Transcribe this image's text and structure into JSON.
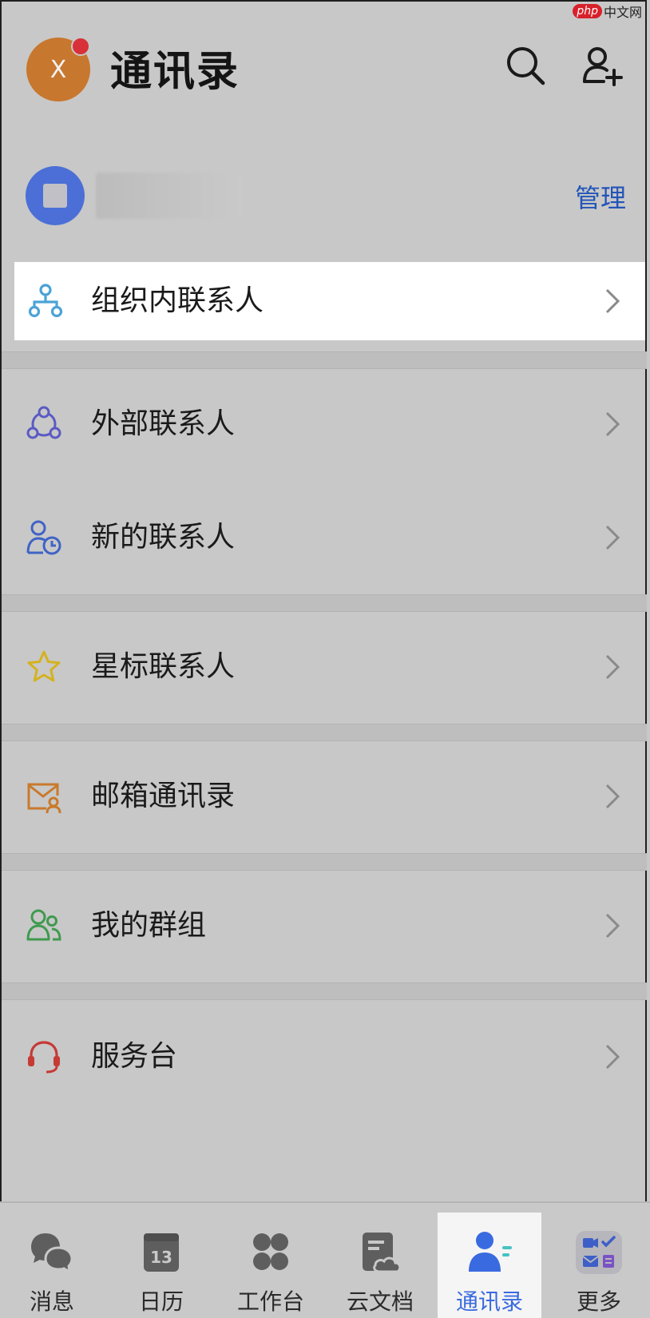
{
  "watermark": {
    "brand": "php",
    "site": "中文网"
  },
  "header": {
    "avatar_letter": "X",
    "title": "通讯录",
    "icons": [
      "search-icon",
      "add-contact-icon"
    ]
  },
  "org": {
    "manage_label": "管理"
  },
  "rows": [
    {
      "label": "组织内联系人",
      "icon": "org-tree-icon",
      "color": "#4ba3d6"
    },
    {
      "label": "外部联系人",
      "icon": "external-contacts-icon",
      "color": "#5b5bc4"
    },
    {
      "label": "新的联系人",
      "icon": "new-contact-clock-icon",
      "color": "#3f63c6"
    },
    {
      "label": "星标联系人",
      "icon": "star-icon",
      "color": "#d4b21f"
    },
    {
      "label": "邮箱通讯录",
      "icon": "mail-contacts-icon",
      "color": "#c87a2c"
    },
    {
      "label": "我的群组",
      "icon": "group-icon",
      "color": "#3f9a4e"
    },
    {
      "label": "服务台",
      "icon": "headset-icon",
      "color": "#c63a35"
    }
  ],
  "tabbar": {
    "active": "通讯录",
    "tabs": [
      {
        "label": "消息",
        "icon": "chat-bubbles-icon"
      },
      {
        "label": "日历",
        "icon": "calendar-icon",
        "calendar_day": "13"
      },
      {
        "label": "工作台",
        "icon": "grid-icon"
      },
      {
        "label": "云文档",
        "icon": "cloud-doc-icon"
      },
      {
        "label": "通讯录",
        "icon": "contacts-icon"
      },
      {
        "label": "更多",
        "icon": "more-apps-icon"
      }
    ]
  },
  "colors": {
    "accent": "#3a6ae0",
    "link": "#2255b8",
    "highlight_row": "#ffffff"
  }
}
